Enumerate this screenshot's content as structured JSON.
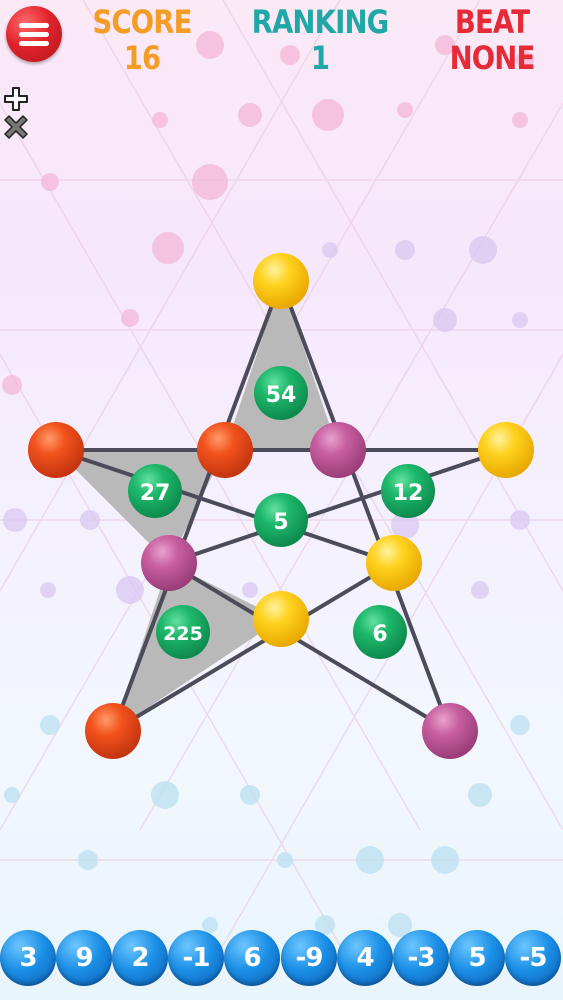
{
  "hud": {
    "score_label": "SCORE",
    "score_value": "16",
    "ranking_label": "RANKING",
    "ranking_value": "1",
    "beat_label": "BEAT",
    "beat_value": "NONE"
  },
  "icons": {
    "menu": "hamburger-menu-icon",
    "add": "plus-icon",
    "remove": "times-icon"
  },
  "colors": {
    "score": "#f39c26",
    "ranking": "#1fa8a5",
    "beat": "#e52a38",
    "node_yellow": "#ffd21f",
    "node_orange": "#f2531d",
    "node_purple": "#c85fa0",
    "face_green": "#1eb86b",
    "tray_blue": "#1b8fe6",
    "filled_region": "#b9b9b9"
  },
  "board": {
    "nodes": [
      {
        "id": "top",
        "color": "yellow"
      },
      {
        "id": "left-tip",
        "color": "orange"
      },
      {
        "id": "inner-top-left",
        "color": "orange"
      },
      {
        "id": "inner-top-right",
        "color": "purple"
      },
      {
        "id": "right-tip",
        "color": "yellow"
      },
      {
        "id": "inner-left",
        "color": "purple"
      },
      {
        "id": "inner-right",
        "color": "yellow"
      },
      {
        "id": "inner-bottom",
        "color": "yellow"
      },
      {
        "id": "bottom-left-tip",
        "color": "orange"
      },
      {
        "id": "bottom-right-tip",
        "color": "purple"
      }
    ],
    "faces": [
      {
        "id": "top-point",
        "value": "54",
        "filled": true
      },
      {
        "id": "left-point",
        "value": "27",
        "filled": true
      },
      {
        "id": "center",
        "value": "5",
        "filled": false
      },
      {
        "id": "right-point",
        "value": "12",
        "filled": false
      },
      {
        "id": "bottom-left-point",
        "value": "225",
        "filled": true
      },
      {
        "id": "bottom-right-point",
        "value": "6",
        "filled": false
      }
    ]
  },
  "tray": [
    "3",
    "9",
    "2",
    "-1",
    "6",
    "-9",
    "4",
    "-3",
    "5",
    "-5"
  ]
}
